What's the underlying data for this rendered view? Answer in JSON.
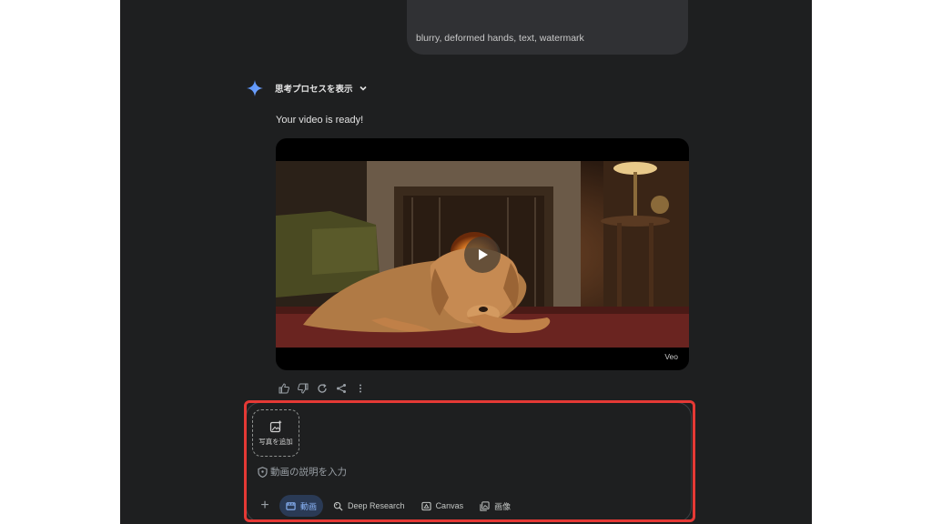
{
  "conversation": {
    "user_prompt_tail": "blurry, deformed hands, text, watermark",
    "thinking_toggle_label": "思考プロセスを表示",
    "response_text": "Your video is ready!",
    "video": {
      "badge": "Veo"
    }
  },
  "input": {
    "add_photo_label": "写真を追加",
    "placeholder": "動画の説明を入力",
    "tools": [
      {
        "label": "動画",
        "icon": "video-icon",
        "active": true
      },
      {
        "label": "Deep Research",
        "icon": "deep-research-icon",
        "active": false
      },
      {
        "label": "Canvas",
        "icon": "canvas-icon",
        "active": false
      },
      {
        "label": "画像",
        "icon": "image-icon",
        "active": false
      }
    ]
  },
  "colors": {
    "background": "#1e1f20",
    "accent": "#8ab4f8",
    "highlight": "#e53935"
  }
}
